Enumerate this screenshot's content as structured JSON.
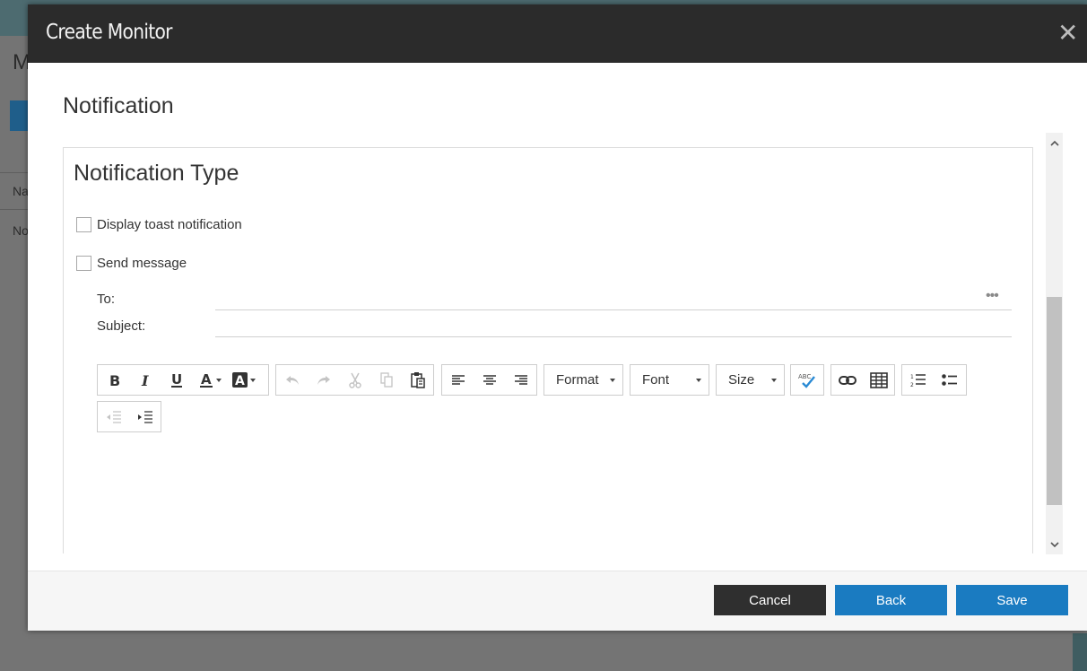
{
  "background": {
    "title_fragment": "M",
    "col_fragment": "Na",
    "row_fragment": "No"
  },
  "dialog": {
    "title": "Create Monitor",
    "close_icon": "close-icon",
    "section_title": "Notification",
    "panel_title": "Notification Type",
    "options": {
      "toast_label": "Display toast notification",
      "message_label": "Send message"
    },
    "fields": {
      "to_label": "To:",
      "to_value": "",
      "subject_label": "Subject:",
      "subject_value": ""
    },
    "toolbar": {
      "format_label": "Format",
      "font_label": "Font",
      "size_label": "Size"
    },
    "footer": {
      "cancel_label": "Cancel",
      "back_label": "Back",
      "save_label": "Save"
    }
  },
  "colors": {
    "header_bg": "#2b2b2b",
    "primary_button": "#1a7bc1",
    "cancel_button": "#2f2f2f"
  }
}
